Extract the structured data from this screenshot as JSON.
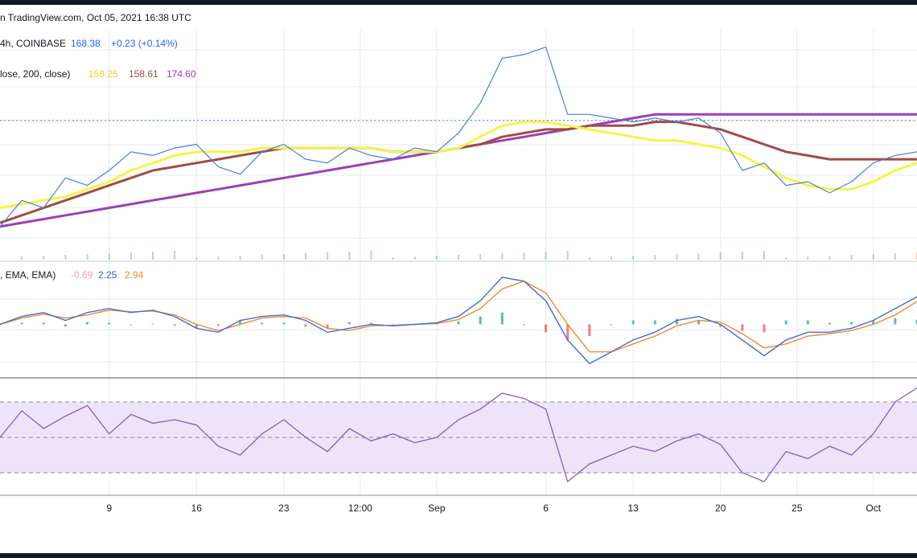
{
  "header": {
    "caption": "n TradingView.com, Oct 05, 2021 16:38 UTC",
    "symbol_text": "4h, COINBASE",
    "price": "168.38",
    "change": "+0.23 (+0.14%)"
  },
  "ma_legend": {
    "text": "lose, 200, close)",
    "values": [
      "158.25",
      "158.61",
      "174.60"
    ]
  },
  "macd_legend": {
    "text": ", EMA, EMA)",
    "values": [
      "-0.69",
      "2.25",
      "2.94"
    ]
  },
  "colors": {
    "background": "#ffffff",
    "frame": "#131722",
    "grid": "#e3eaf3",
    "price": "#4a7fd9",
    "ma_yellow": "#f7f34b",
    "ma_brown": "#a04c46",
    "ma_purple": "#9c3fb5",
    "macd_line": "#3f6fd6",
    "signal_line": "#f28a2a",
    "hist_pos": "#26a69a",
    "hist_neg": "#ef5350",
    "rsi_line": "#8a5bc0",
    "rsi_band": "#ede4fa",
    "text_dark": "#131722"
  },
  "x_axis": {
    "ticks": [
      {
        "label": "9",
        "t": 0.5
      },
      {
        "label": "16",
        "t": 0.9
      },
      {
        "label": "23",
        "t": 1.3
      },
      {
        "label": "12:00",
        "t": 1.65
      },
      {
        "label": "Sep",
        "t": 2.0
      },
      {
        "label": "6",
        "t": 2.5
      },
      {
        "label": "13",
        "t": 2.9
      },
      {
        "label": "20",
        "t": 3.3
      },
      {
        "label": "25",
        "t": 3.65
      },
      {
        "label": "Oct",
        "t": 4.0
      }
    ]
  },
  "chart_data": [
    {
      "type": "line",
      "panel": "price",
      "x": [
        0.0,
        0.1,
        0.2,
        0.3,
        0.4,
        0.5,
        0.6,
        0.7,
        0.8,
        0.9,
        1.0,
        1.1,
        1.2,
        1.3,
        1.4,
        1.5,
        1.6,
        1.7,
        1.8,
        1.9,
        2.0,
        2.1,
        2.2,
        2.3,
        2.4,
        2.5,
        2.6,
        2.7,
        2.8,
        2.9,
        3.0,
        3.1,
        3.2,
        3.3,
        3.4,
        3.5,
        3.6,
        3.7,
        3.8,
        3.9,
        4.0,
        4.1,
        4.2
      ],
      "series": [
        {
          "values": [
            140,
            147,
            145,
            153,
            151,
            155,
            160,
            159,
            161,
            162,
            156,
            154,
            160,
            162,
            158,
            157,
            161,
            159,
            158,
            161,
            160,
            165,
            173,
            185,
            186,
            188,
            170,
            170,
            169,
            168,
            169,
            168,
            169,
            165,
            155,
            157,
            151,
            152,
            149,
            152,
            157,
            159,
            160
          ]
        },
        {
          "values": [
            145,
            146,
            147,
            148,
            150,
            152,
            155,
            157,
            159,
            160,
            160,
            160,
            161,
            161,
            161,
            161,
            161,
            161,
            160,
            160,
            160,
            161,
            164,
            167,
            168,
            168,
            167,
            166,
            165,
            164,
            163,
            163,
            162,
            161,
            159,
            156,
            153,
            151,
            150,
            150,
            152,
            155,
            157
          ]
        },
        {
          "values": [
            141,
            143,
            145,
            147,
            149,
            151,
            153,
            155,
            156,
            157,
            158,
            159,
            160,
            161,
            161,
            161,
            161,
            161,
            160,
            160,
            160,
            161,
            162,
            164,
            165,
            166,
            166,
            167,
            167,
            167,
            168,
            168,
            167,
            166,
            164,
            162,
            160,
            159,
            158,
            158,
            158,
            158,
            158
          ]
        },
        {
          "values": [
            140,
            141,
            142,
            143,
            144,
            145,
            146,
            147,
            148,
            149,
            150,
            151,
            152,
            153,
            154,
            155,
            156,
            157,
            158,
            159,
            160,
            161,
            162,
            163,
            164,
            165,
            166,
            167,
            168,
            169,
            170,
            170,
            170,
            170,
            170,
            170,
            170,
            170,
            170,
            170,
            170,
            170,
            170
          ]
        }
      ],
      "last_price": 168.38
    },
    {
      "type": "line",
      "panel": "macd",
      "x": [
        0.0,
        0.1,
        0.2,
        0.3,
        0.4,
        0.5,
        0.6,
        0.7,
        0.8,
        0.9,
        1.0,
        1.1,
        1.2,
        1.3,
        1.4,
        1.5,
        1.6,
        1.7,
        1.8,
        1.9,
        2.0,
        2.1,
        2.2,
        2.3,
        2.4,
        2.5,
        2.6,
        2.7,
        2.8,
        2.9,
        3.0,
        3.1,
        3.2,
        3.3,
        3.4,
        3.5,
        3.6,
        3.7,
        3.8,
        3.9,
        4.0,
        4.1,
        4.2
      ],
      "series": [
        {
          "values": [
            0.0,
            1.0,
            1.5,
            0.5,
            1.5,
            2.0,
            1.5,
            1.8,
            1.0,
            -0.5,
            -1.0,
            0.5,
            1.0,
            1.2,
            0.5,
            -1.0,
            -0.5,
            0.0,
            -0.2,
            0.0,
            0.2,
            1.0,
            3.0,
            6.0,
            5.5,
            3.0,
            -2.0,
            -5.0,
            -3.5,
            -2.0,
            -1.0,
            0.5,
            1.0,
            0.0,
            -2.0,
            -4.0,
            -2.0,
            -1.0,
            -1.0,
            -0.5,
            0.5,
            2.0,
            3.5
          ]
        },
        {
          "values": [
            0.0,
            0.8,
            1.3,
            0.8,
            1.2,
            1.8,
            1.6,
            1.7,
            1.2,
            0.0,
            -0.8,
            0.0,
            0.8,
            1.0,
            0.8,
            -0.5,
            -0.8,
            -0.2,
            -0.1,
            0.0,
            0.1,
            0.6,
            2.0,
            4.5,
            5.5,
            4.0,
            0.0,
            -3.5,
            -3.5,
            -2.5,
            -1.5,
            -0.2,
            0.5,
            0.3,
            -1.2,
            -3.0,
            -2.5,
            -1.5,
            -1.2,
            -0.8,
            0.0,
            1.2,
            2.9
          ]
        }
      ]
    },
    {
      "type": "line",
      "panel": "rsi",
      "x": [
        0.0,
        0.1,
        0.2,
        0.3,
        0.4,
        0.5,
        0.6,
        0.7,
        0.8,
        0.9,
        1.0,
        1.1,
        1.2,
        1.3,
        1.4,
        1.5,
        1.6,
        1.7,
        1.8,
        1.9,
        2.0,
        2.1,
        2.2,
        2.3,
        2.4,
        2.5,
        2.6,
        2.7,
        2.8,
        2.9,
        3.0,
        3.1,
        3.2,
        3.3,
        3.4,
        3.5,
        3.6,
        3.7,
        3.8,
        3.9,
        4.0,
        4.1,
        4.2
      ],
      "series": [
        {
          "values": [
            50,
            65,
            55,
            62,
            68,
            52,
            63,
            58,
            60,
            57,
            45,
            40,
            52,
            60,
            50,
            42,
            55,
            48,
            52,
            47,
            50,
            60,
            66,
            75,
            72,
            66,
            25,
            35,
            40,
            45,
            42,
            48,
            52,
            46,
            30,
            25,
            42,
            38,
            45,
            40,
            52,
            70,
            78
          ]
        }
      ],
      "ylim": [
        20,
        80
      ],
      "bands": [
        30,
        50,
        70
      ]
    }
  ]
}
